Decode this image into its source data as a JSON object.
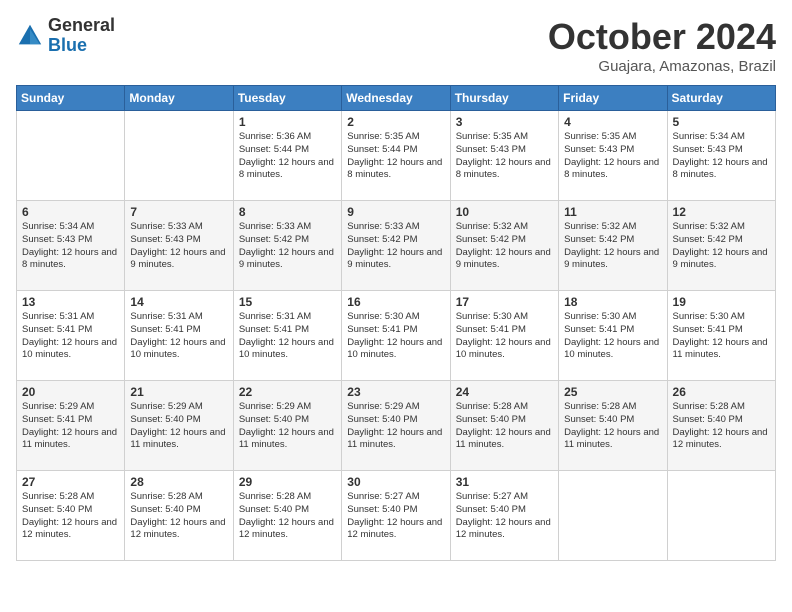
{
  "header": {
    "logo_general": "General",
    "logo_blue": "Blue",
    "month_title": "October 2024",
    "location": "Guajara, Amazonas, Brazil"
  },
  "weekdays": [
    "Sunday",
    "Monday",
    "Tuesday",
    "Wednesday",
    "Thursday",
    "Friday",
    "Saturday"
  ],
  "weeks": [
    [
      {
        "day": "",
        "text": ""
      },
      {
        "day": "",
        "text": ""
      },
      {
        "day": "1",
        "text": "Sunrise: 5:36 AM\nSunset: 5:44 PM\nDaylight: 12 hours and 8 minutes."
      },
      {
        "day": "2",
        "text": "Sunrise: 5:35 AM\nSunset: 5:44 PM\nDaylight: 12 hours and 8 minutes."
      },
      {
        "day": "3",
        "text": "Sunrise: 5:35 AM\nSunset: 5:43 PM\nDaylight: 12 hours and 8 minutes."
      },
      {
        "day": "4",
        "text": "Sunrise: 5:35 AM\nSunset: 5:43 PM\nDaylight: 12 hours and 8 minutes."
      },
      {
        "day": "5",
        "text": "Sunrise: 5:34 AM\nSunset: 5:43 PM\nDaylight: 12 hours and 8 minutes."
      }
    ],
    [
      {
        "day": "6",
        "text": "Sunrise: 5:34 AM\nSunset: 5:43 PM\nDaylight: 12 hours and 8 minutes."
      },
      {
        "day": "7",
        "text": "Sunrise: 5:33 AM\nSunset: 5:43 PM\nDaylight: 12 hours and 9 minutes."
      },
      {
        "day": "8",
        "text": "Sunrise: 5:33 AM\nSunset: 5:42 PM\nDaylight: 12 hours and 9 minutes."
      },
      {
        "day": "9",
        "text": "Sunrise: 5:33 AM\nSunset: 5:42 PM\nDaylight: 12 hours and 9 minutes."
      },
      {
        "day": "10",
        "text": "Sunrise: 5:32 AM\nSunset: 5:42 PM\nDaylight: 12 hours and 9 minutes."
      },
      {
        "day": "11",
        "text": "Sunrise: 5:32 AM\nSunset: 5:42 PM\nDaylight: 12 hours and 9 minutes."
      },
      {
        "day": "12",
        "text": "Sunrise: 5:32 AM\nSunset: 5:42 PM\nDaylight: 12 hours and 9 minutes."
      }
    ],
    [
      {
        "day": "13",
        "text": "Sunrise: 5:31 AM\nSunset: 5:41 PM\nDaylight: 12 hours and 10 minutes."
      },
      {
        "day": "14",
        "text": "Sunrise: 5:31 AM\nSunset: 5:41 PM\nDaylight: 12 hours and 10 minutes."
      },
      {
        "day": "15",
        "text": "Sunrise: 5:31 AM\nSunset: 5:41 PM\nDaylight: 12 hours and 10 minutes."
      },
      {
        "day": "16",
        "text": "Sunrise: 5:30 AM\nSunset: 5:41 PM\nDaylight: 12 hours and 10 minutes."
      },
      {
        "day": "17",
        "text": "Sunrise: 5:30 AM\nSunset: 5:41 PM\nDaylight: 12 hours and 10 minutes."
      },
      {
        "day": "18",
        "text": "Sunrise: 5:30 AM\nSunset: 5:41 PM\nDaylight: 12 hours and 10 minutes."
      },
      {
        "day": "19",
        "text": "Sunrise: 5:30 AM\nSunset: 5:41 PM\nDaylight: 12 hours and 11 minutes."
      }
    ],
    [
      {
        "day": "20",
        "text": "Sunrise: 5:29 AM\nSunset: 5:41 PM\nDaylight: 12 hours and 11 minutes."
      },
      {
        "day": "21",
        "text": "Sunrise: 5:29 AM\nSunset: 5:40 PM\nDaylight: 12 hours and 11 minutes."
      },
      {
        "day": "22",
        "text": "Sunrise: 5:29 AM\nSunset: 5:40 PM\nDaylight: 12 hours and 11 minutes."
      },
      {
        "day": "23",
        "text": "Sunrise: 5:29 AM\nSunset: 5:40 PM\nDaylight: 12 hours and 11 minutes."
      },
      {
        "day": "24",
        "text": "Sunrise: 5:28 AM\nSunset: 5:40 PM\nDaylight: 12 hours and 11 minutes."
      },
      {
        "day": "25",
        "text": "Sunrise: 5:28 AM\nSunset: 5:40 PM\nDaylight: 12 hours and 11 minutes."
      },
      {
        "day": "26",
        "text": "Sunrise: 5:28 AM\nSunset: 5:40 PM\nDaylight: 12 hours and 12 minutes."
      }
    ],
    [
      {
        "day": "27",
        "text": "Sunrise: 5:28 AM\nSunset: 5:40 PM\nDaylight: 12 hours and 12 minutes."
      },
      {
        "day": "28",
        "text": "Sunrise: 5:28 AM\nSunset: 5:40 PM\nDaylight: 12 hours and 12 minutes."
      },
      {
        "day": "29",
        "text": "Sunrise: 5:28 AM\nSunset: 5:40 PM\nDaylight: 12 hours and 12 minutes."
      },
      {
        "day": "30",
        "text": "Sunrise: 5:27 AM\nSunset: 5:40 PM\nDaylight: 12 hours and 12 minutes."
      },
      {
        "day": "31",
        "text": "Sunrise: 5:27 AM\nSunset: 5:40 PM\nDaylight: 12 hours and 12 minutes."
      },
      {
        "day": "",
        "text": ""
      },
      {
        "day": "",
        "text": ""
      }
    ]
  ]
}
